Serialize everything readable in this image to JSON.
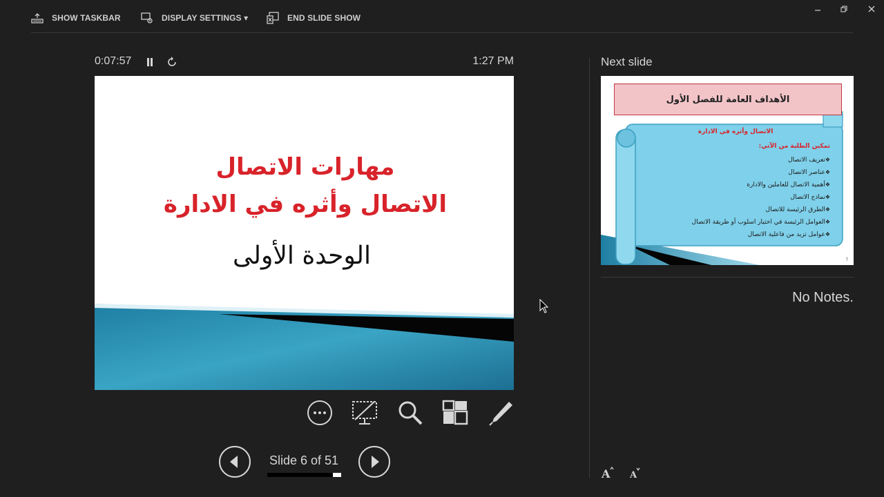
{
  "toolbar": {
    "show_taskbar": "SHOW TASKBAR",
    "display_settings": "DISPLAY SETTINGS ▾",
    "end_slide_show": "END SLIDE SHOW"
  },
  "presenter": {
    "timer": "0:07:57",
    "clock": "1:27 PM",
    "slide_counter": "Slide 6 of 51",
    "current_slide_index": 6,
    "total_slides": 51
  },
  "current_slide": {
    "title_line1": "مهارات الاتصال",
    "title_line2": "الاتصال وأثره في الادارة",
    "subtitle": "الوحدة الأولى"
  },
  "next_slide": {
    "label": "Next slide",
    "header": "الأهداف العامة للفصل الأول",
    "scroll_title": "الاتصال وأثره في الادارة",
    "intro": "تمكين الطلبة من الآتي:",
    "items": [
      "تعريف الاتصال",
      "عناصر الاتصال",
      "أهمية الاتصال للعاملين والادارة",
      "نماذج الاتصال",
      "الطرق الرئيسة للاتصال",
      "العوامل الرئيسة في اختيار اسلوب أو طريقة الاتصال",
      "عوامل تزيد من فاعلية الاتصال"
    ],
    "page_number": "7"
  },
  "notes": {
    "text": "No Notes."
  },
  "icons": {
    "taskbar": "taskbar-icon",
    "display": "display-settings-icon",
    "end": "end-show-icon",
    "pause": "pause-icon",
    "reset": "reset-timer-icon",
    "more": "more-options-icon",
    "black_screen": "black-screen-icon",
    "zoom": "zoom-icon",
    "see_all": "see-all-slides-icon",
    "pen": "pen-icon",
    "prev": "previous-slide-icon",
    "next": "next-slide-icon",
    "font_up": "increase-font-icon",
    "font_down": "decrease-font-icon"
  },
  "colors": {
    "background": "#1f1f1f",
    "title_red": "#d8232a",
    "teal": "#2a8fb0",
    "scroll_blue": "#7fd0ea"
  }
}
